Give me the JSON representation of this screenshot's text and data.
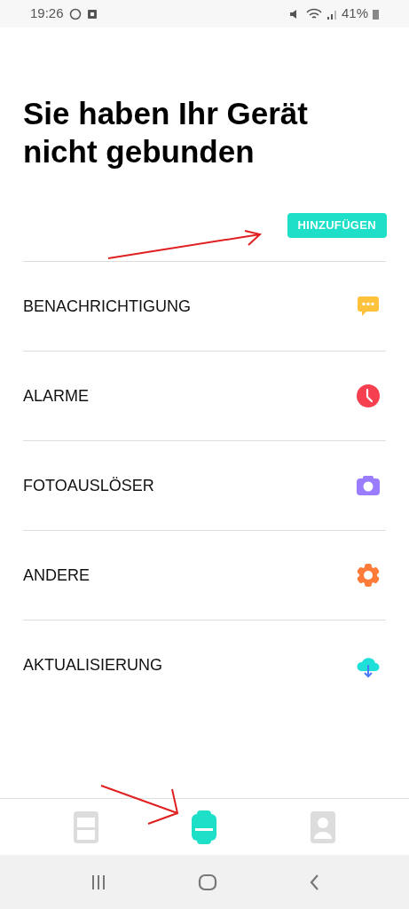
{
  "status_bar": {
    "time": "19:26",
    "battery": "41%"
  },
  "title": "Sie haben Ihr Gerät nicht gebunden",
  "add_button": "HINZUFÜGEN",
  "menu_items": [
    {
      "label": "BENACHRICHTIGUNG",
      "kind": "message"
    },
    {
      "label": "ALARME",
      "kind": "alarm"
    },
    {
      "label": "FOTOAUSLÖSER",
      "kind": "camera"
    },
    {
      "label": "ANDERE",
      "kind": "settings"
    },
    {
      "label": "AKTUALISIERUNG",
      "kind": "update"
    }
  ],
  "bottom_tabs": [
    {
      "kind": "list",
      "selected": false
    },
    {
      "kind": "watch",
      "selected": true
    },
    {
      "kind": "profile",
      "selected": false
    }
  ]
}
